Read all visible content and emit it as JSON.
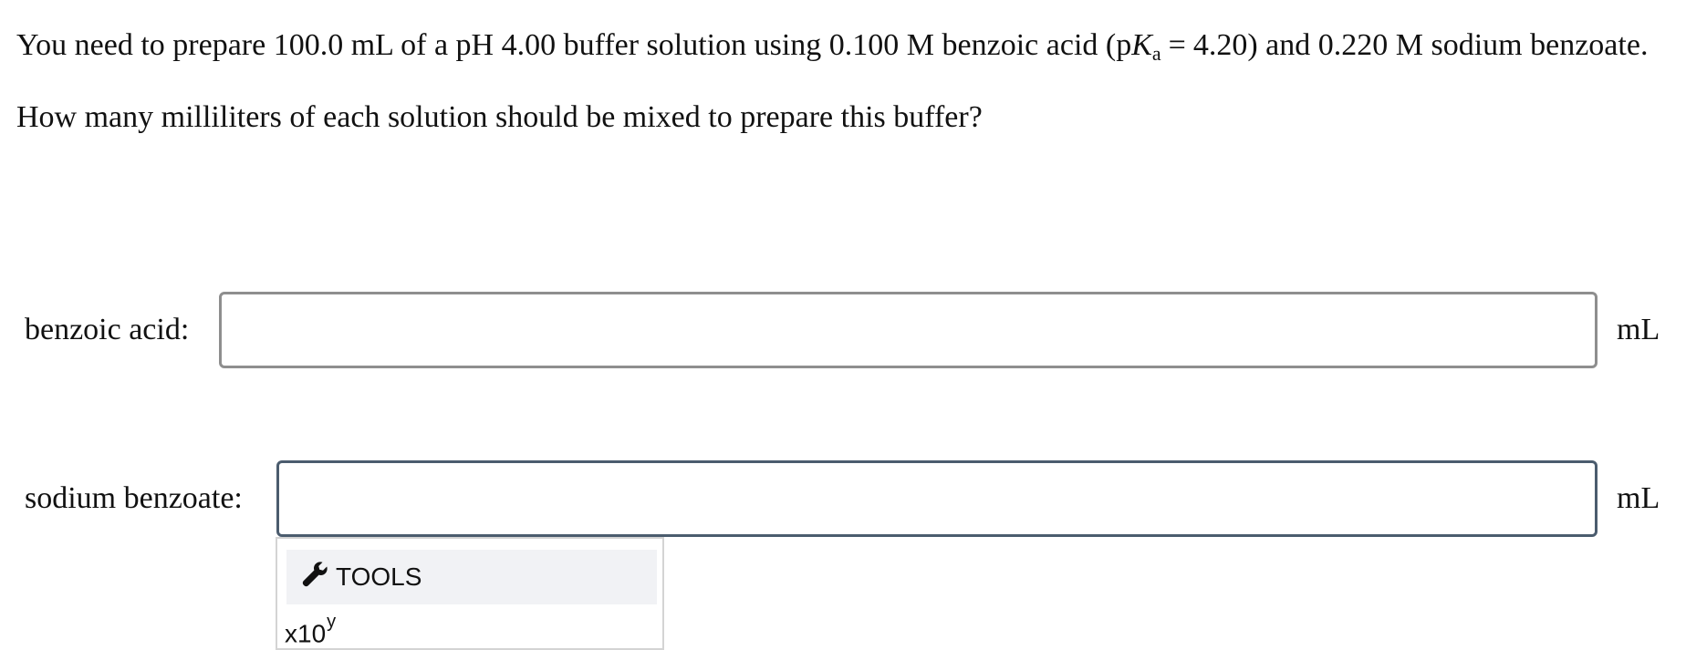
{
  "question": {
    "intro_before_pka": "You need to prepare 100.0 mL of a pH 4.00 buffer solution using 0.100 M benzoic acid (p",
    "pka_symbol": "K",
    "pka_subscript": "a",
    "equals": "=",
    "intro_after_pka": "4.20) and 0.220 M sodium benzoate.",
    "prompt": "How many milliliters of each solution should be mixed to prepare this buffer?"
  },
  "fields": [
    {
      "label": "benzoic acid:",
      "value": "",
      "unit": "mL"
    },
    {
      "label": "sodium benzoate:",
      "value": "",
      "unit": "mL"
    }
  ],
  "tools": {
    "icon": "wrench-icon",
    "header_label": "TOOLS",
    "x10_base": "x10",
    "x10_exponent": "y"
  }
}
